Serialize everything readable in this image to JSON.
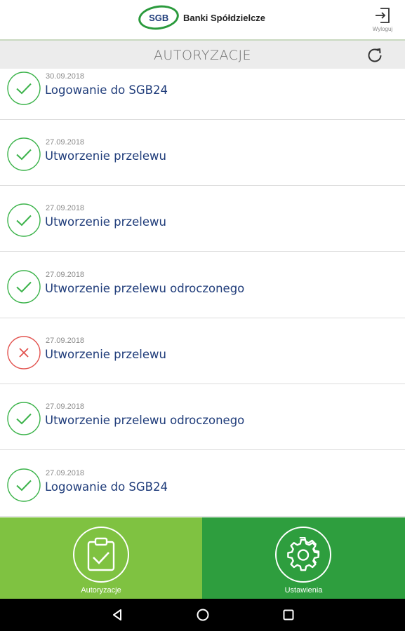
{
  "header": {
    "logo_mark": "SGB",
    "logo_text": "Banki Spółdzielcze",
    "logout_label": "Wyloguj"
  },
  "titlebar": {
    "title": "AUTORYZACJE"
  },
  "items": [
    {
      "date": "30.09.2018",
      "title": "Logowanie do SGB24",
      "status": "success"
    },
    {
      "date": "27.09.2018",
      "title": "Utworzenie przelewu",
      "status": "success"
    },
    {
      "date": "27.09.2018",
      "title": "Utworzenie przelewu",
      "status": "success"
    },
    {
      "date": "27.09.2018",
      "title": "Utworzenie przelewu odroczonego",
      "status": "success"
    },
    {
      "date": "27.09.2018",
      "title": "Utworzenie przelewu",
      "status": "rejected"
    },
    {
      "date": "27.09.2018",
      "title": "Utworzenie przelewu odroczonego",
      "status": "success"
    },
    {
      "date": "27.09.2018",
      "title": "Logowanie do SGB24",
      "status": "success"
    }
  ],
  "bottom_nav": {
    "authorizations_label": "Autoryzacje",
    "settings_label": "Ustawienia"
  },
  "colors": {
    "success": "#3bb34a",
    "rejected": "#e2534f",
    "brand_light_green": "#7fc241",
    "brand_dark_green": "#2e9e3e",
    "title_blue": "#1f3c7a"
  },
  "icons": [
    "logout-icon",
    "refresh-icon",
    "check-icon",
    "x-icon",
    "clipboard-check-icon",
    "gear-icon",
    "back-icon",
    "home-icon",
    "recents-icon"
  ]
}
